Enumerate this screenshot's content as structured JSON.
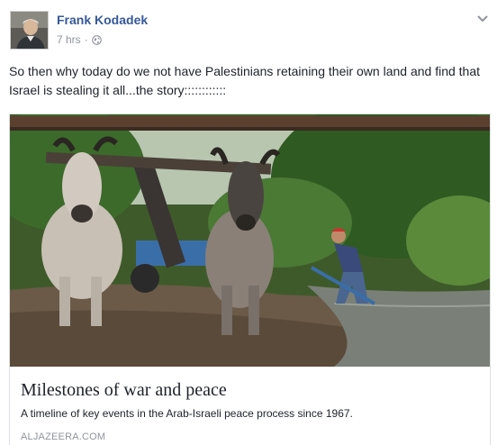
{
  "post": {
    "author": "Frank Kodadek",
    "timestamp": "7 hrs",
    "separator": "·",
    "privacy_icon": "globe-icon",
    "menu_icon": "chevron-down-icon",
    "text": "So then why today do we not have Palestinians retaining their own land and find that Israel is stealing it all...the story::::::::::::"
  },
  "link": {
    "title": "Milestones of war and peace",
    "description": "A timeline of key events in the Arab-Israeli peace process since 1967.",
    "domain": "ALJAZEERA.COM"
  },
  "colors": {
    "author": "#365899",
    "meta": "#90949c",
    "text": "#1d2129",
    "border": "#dddfe2"
  }
}
